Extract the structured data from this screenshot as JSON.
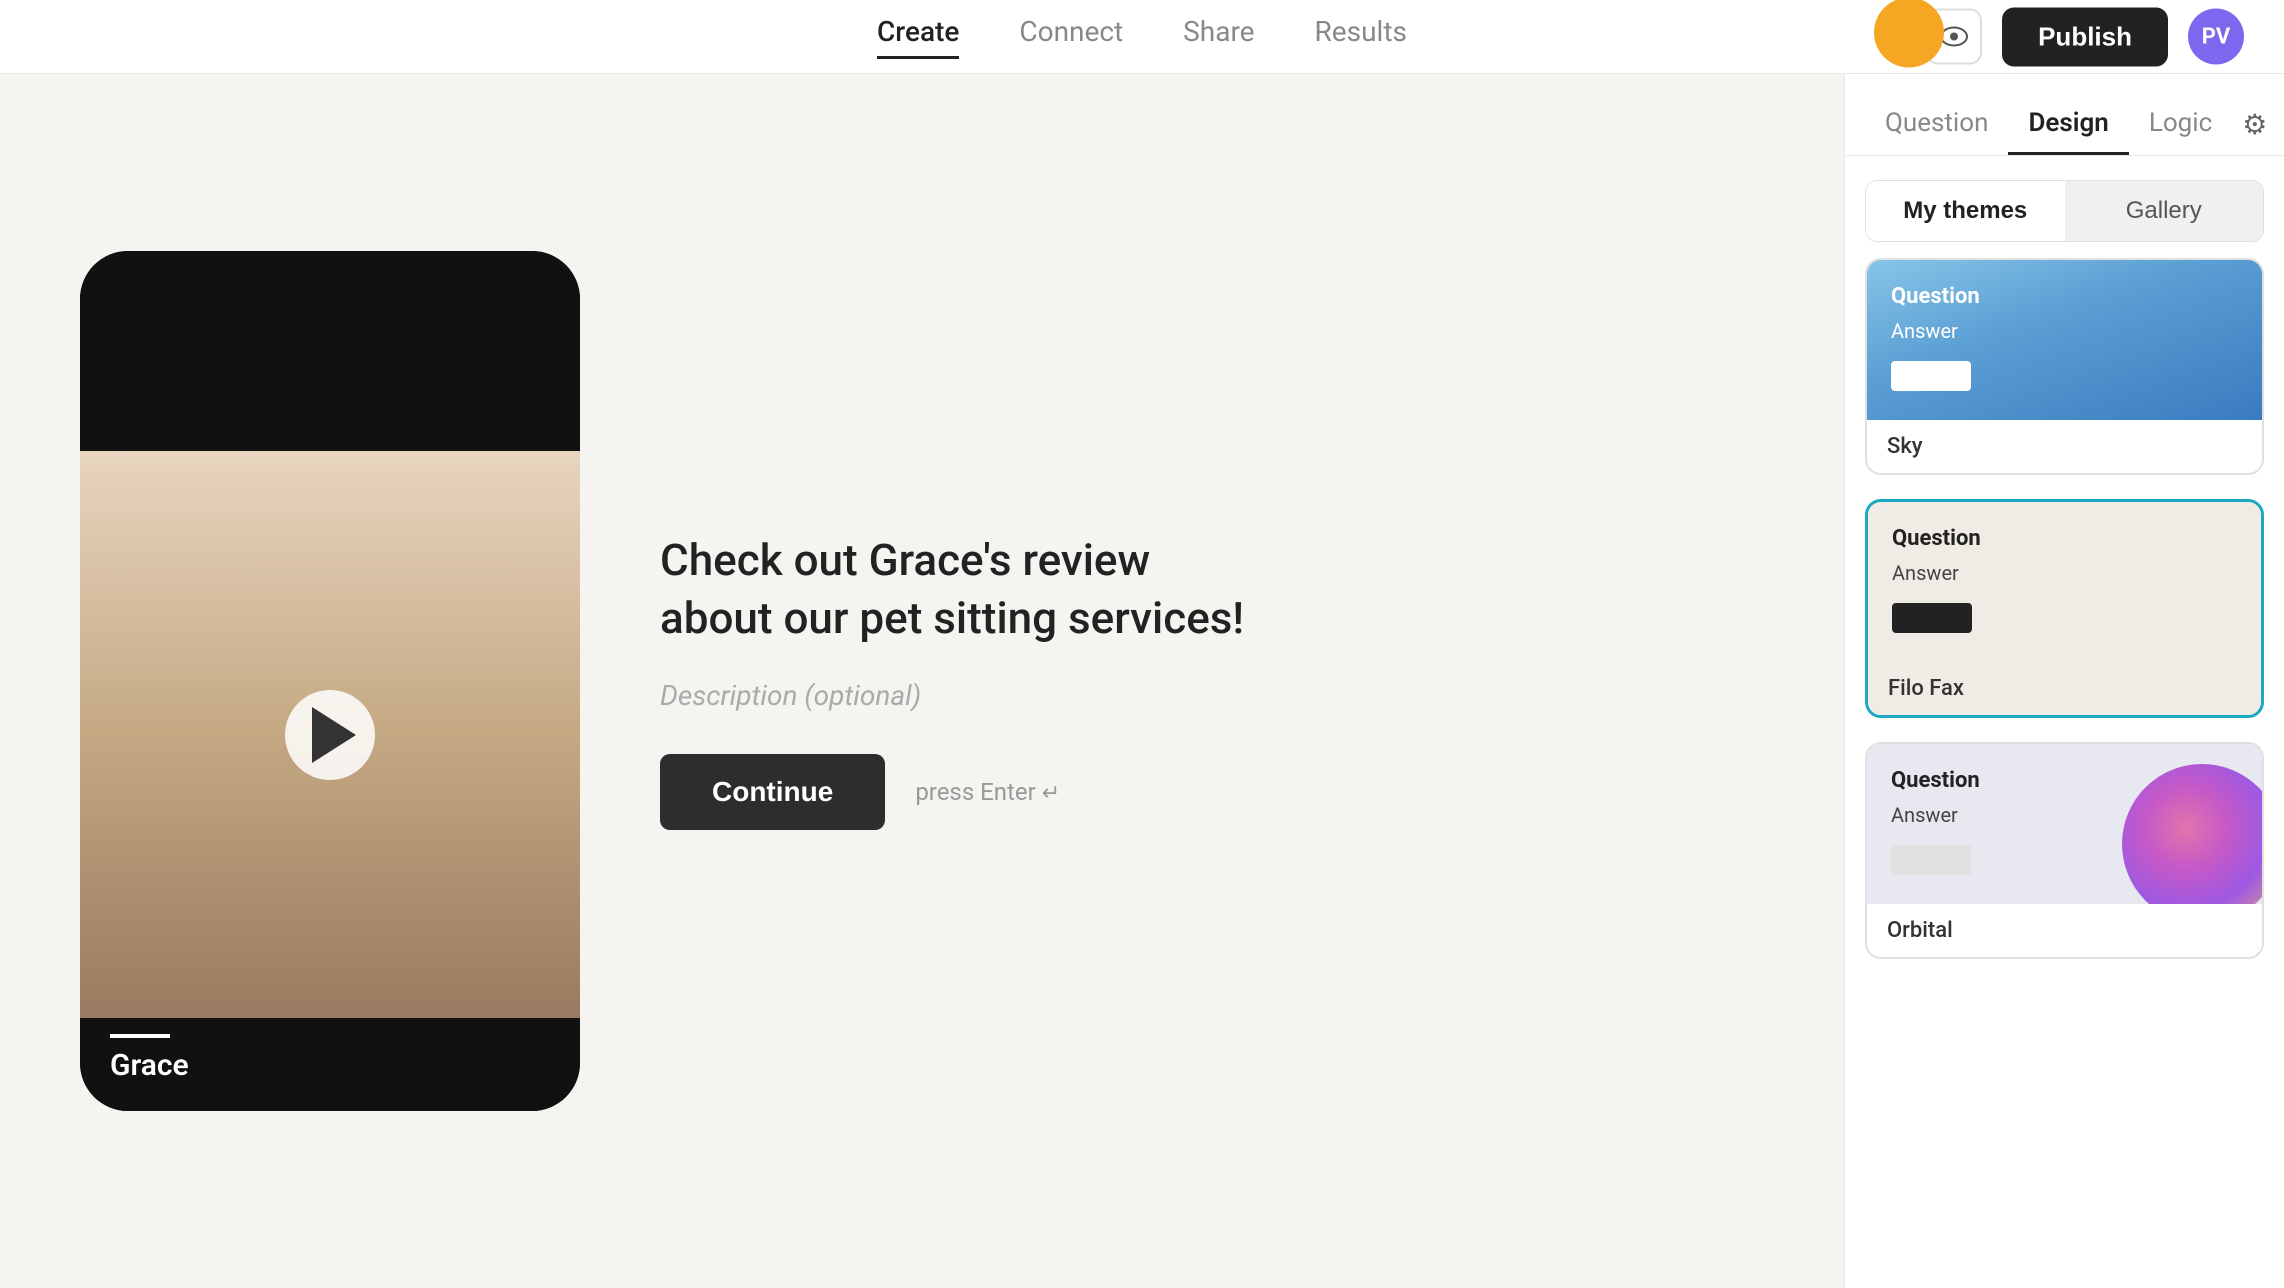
{
  "nav": {
    "tabs": [
      {
        "label": "Create",
        "active": true
      },
      {
        "label": "Connect",
        "active": false
      },
      {
        "label": "Share",
        "active": false
      },
      {
        "label": "Results",
        "active": false
      }
    ],
    "publish_label": "Publish",
    "avatar_label": "PV"
  },
  "sidebar": {
    "tabs": [
      {
        "label": "Question",
        "active": false
      },
      {
        "label": "Design",
        "active": true
      },
      {
        "label": "Logic",
        "active": false
      }
    ],
    "theme_toggle": {
      "my_themes": "My themes",
      "gallery": "Gallery"
    },
    "themes": [
      {
        "name": "Sky",
        "selected": false,
        "style": "sky",
        "question": "Question",
        "answer": "Answer",
        "btn_style": "white"
      },
      {
        "name": "Filo Fax",
        "selected": true,
        "style": "filo-fax",
        "question": "Question",
        "answer": "Answer",
        "btn_style": "dark"
      },
      {
        "name": "Orbital",
        "selected": false,
        "style": "orbital",
        "question": "Question",
        "answer": "Answer",
        "btn_style": "dark"
      }
    ]
  },
  "main": {
    "title": "Check out Grace's review about our pet sitting services!",
    "description": "Description (optional)",
    "continue_label": "Continue",
    "press_enter_text": "press Enter",
    "person_name": "Grace"
  }
}
